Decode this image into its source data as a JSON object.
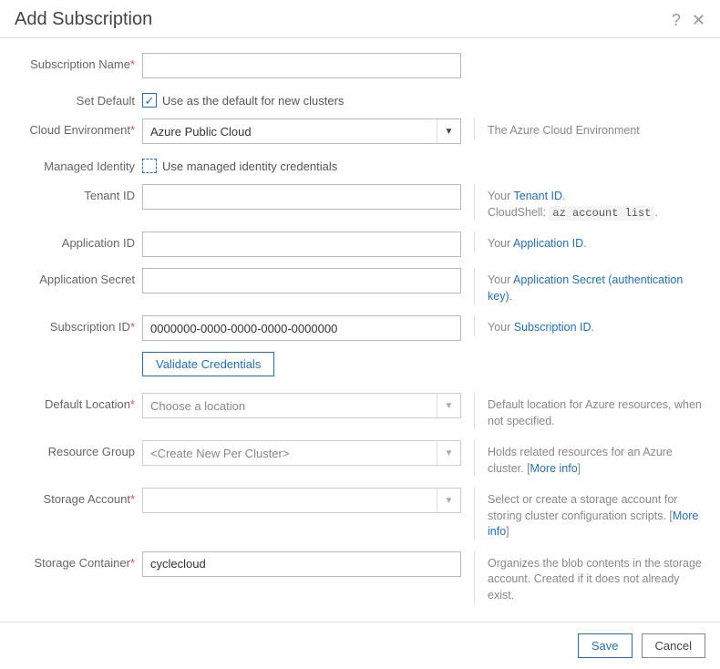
{
  "dialog": {
    "title": "Add Subscription"
  },
  "labels": {
    "subscription_name": "Subscription Name",
    "set_default": "Set Default",
    "cloud_environment": "Cloud Environment",
    "managed_identity": "Managed Identity",
    "tenant_id": "Tenant ID",
    "application_id": "Application ID",
    "application_secret": "Application Secret",
    "subscription_id": "Subscription ID",
    "default_location": "Default Location",
    "resource_group": "Resource Group",
    "storage_account": "Storage Account",
    "storage_container": "Storage Container"
  },
  "values": {
    "subscription_name": "",
    "set_default_checked": true,
    "set_default_label": "Use as the default for new clusters",
    "cloud_environment": "Azure Public Cloud",
    "managed_identity_checked": false,
    "managed_identity_label": "Use managed identity credentials",
    "tenant_id": "",
    "application_id": "",
    "application_secret": "",
    "subscription_id": "0000000-0000-0000-0000-0000000",
    "default_location": "Choose a location",
    "resource_group": "<Create New Per Cluster>",
    "storage_account": "",
    "storage_container": "cyclecloud"
  },
  "buttons": {
    "validate": "Validate Credentials",
    "save": "Save",
    "cancel": "Cancel"
  },
  "help": {
    "cloud_environment": "The Azure Cloud Environment",
    "tenant_prefix": "Your ",
    "tenant_link": "Tenant ID",
    "tenant_suffix": ".",
    "cloudshell_label": "CloudShell: ",
    "cloudshell_cmd": "az account list",
    "cloudshell_suffix": ".",
    "application_id_prefix": "Your ",
    "application_id_link": "Application ID",
    "application_id_suffix": ".",
    "application_secret_prefix": "Your ",
    "application_secret_link": "Application Secret (authentication key)",
    "application_secret_suffix": ".",
    "subscription_id_prefix": "Your ",
    "subscription_id_link": "Subscription ID",
    "subscription_id_suffix": ".",
    "default_location": "Default location for Azure resources, when not specified.",
    "resource_group_text": "Holds related resources for an Azure cluster. [",
    "resource_group_link": "More info",
    "resource_group_suffix": "]",
    "storage_account_text": "Select or create a storage account for storing cluster configuration scripts. [",
    "storage_account_link": "More info",
    "storage_account_suffix": "]",
    "storage_container": "Organizes the blob contents in the storage account. Created if it does not already exist."
  }
}
